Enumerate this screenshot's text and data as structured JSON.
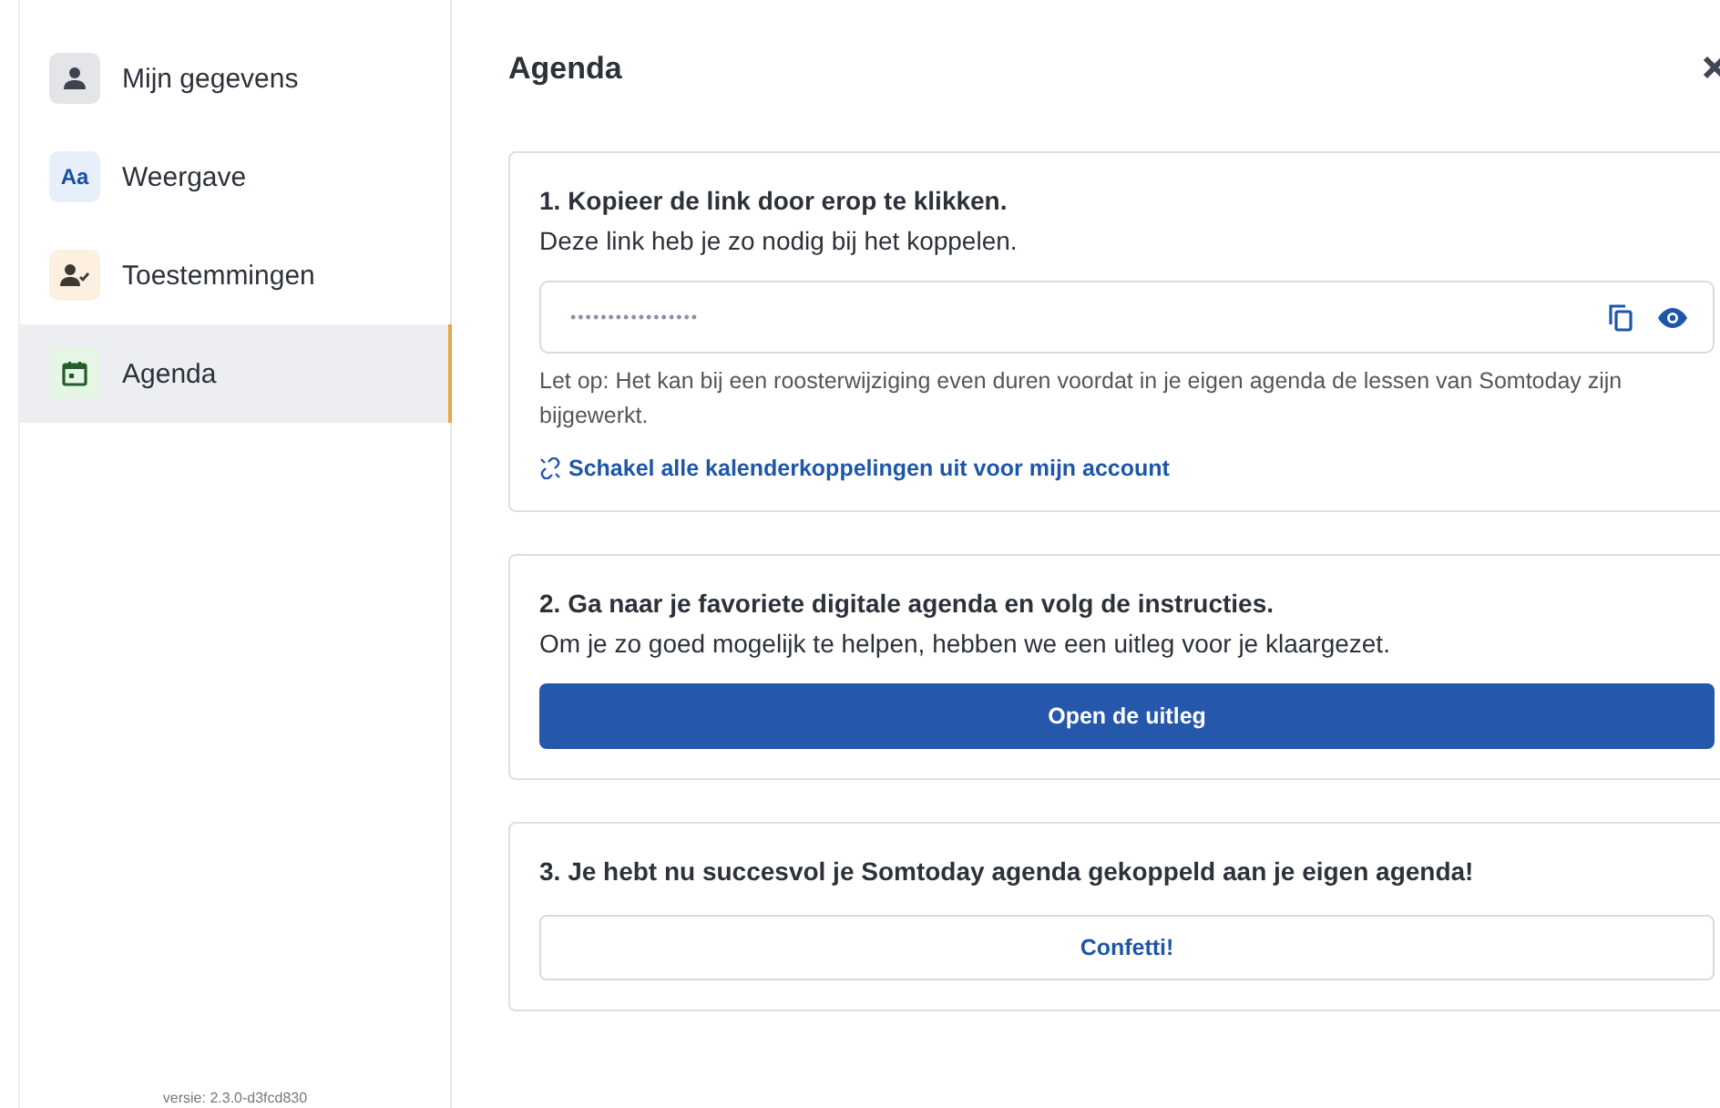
{
  "sidebar": {
    "items": [
      {
        "label": "Mijn gegevens",
        "kind": "person",
        "selected": false
      },
      {
        "label": "Weergave",
        "kind": "text",
        "icon_text": "Aa",
        "selected": false
      },
      {
        "label": "Toestemmingen",
        "kind": "consent",
        "selected": false
      },
      {
        "label": "Agenda",
        "kind": "calendar",
        "selected": true
      }
    ],
    "version": "versie: 2.3.0-d3fcd830"
  },
  "page": {
    "title": "Agenda"
  },
  "cards": [
    {
      "kind": "link",
      "title": "1. Kopieer de link door erop te klikken.",
      "text": "Deze link heb je zo nodig bij het koppelen.",
      "field": {
        "value": "•••••••••••••••••"
      },
      "note": "Let op: Het kan bij een roosterwijziging even duren voordat in je eigen agenda de lessen van Somtoday zijn bijgewerkt.",
      "link": "Schakel alle kalenderkoppelingen uit voor mijn account"
    },
    {
      "kind": "primary",
      "title": "2. Ga naar je favoriete digitale agenda en volg de instructies.",
      "text": "Om je zo goed mogelijk te helpen, hebben we een uitleg voor je klaargezet.",
      "button": "Open de uitleg"
    },
    {
      "kind": "secondary",
      "title": "3. Je hebt nu succesvol je Somtoday agenda gekoppeld aan je eigen agenda!",
      "button": "Confetti!"
    }
  ]
}
